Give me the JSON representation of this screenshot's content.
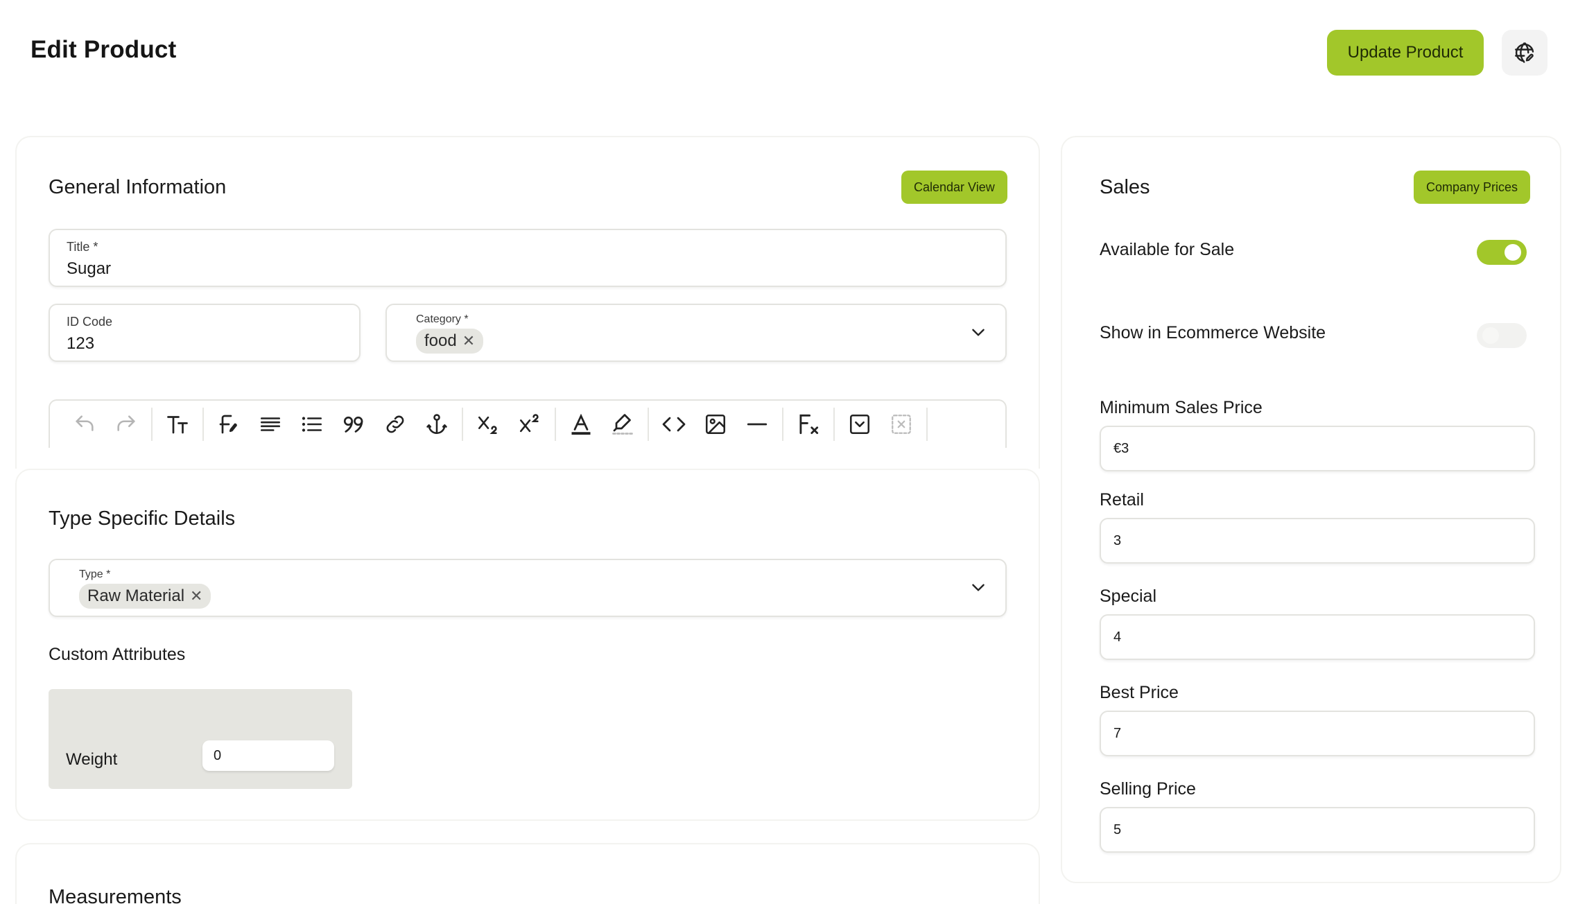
{
  "header": {
    "title": "Edit Product",
    "update_button": "Update Product",
    "language_icon": "globe-edit-icon"
  },
  "general": {
    "title": "General Information",
    "calendar_button": "Calendar View",
    "title_field": {
      "label": "Title *",
      "value": "Sugar"
    },
    "id_field": {
      "label": "ID Code",
      "value": "123"
    },
    "category_field": {
      "label": "Category *",
      "chips": [
        "food"
      ]
    },
    "toolbar_icons": [
      "undo-icon",
      "redo-icon",
      "text-size-icon",
      "font-icon",
      "align-icon",
      "bullet-list-icon",
      "quote-icon",
      "link-icon",
      "anchor-icon",
      "subscript-icon",
      "superscript-icon",
      "text-color-icon",
      "highlight-icon",
      "code-icon",
      "image-icon",
      "horizontal-rule-icon",
      "clear-format-icon",
      "checkbox-icon",
      "remove-icon"
    ]
  },
  "type_details": {
    "title": "Type Specific Details",
    "type_field": {
      "label": "Type *",
      "chips": [
        "Raw Material"
      ]
    },
    "custom_attributes_label": "Custom Attributes",
    "attributes": [
      {
        "label": "Weight",
        "value": "0"
      }
    ]
  },
  "measurements": {
    "title": "Measurements"
  },
  "sales": {
    "title": "Sales",
    "company_prices_button": "Company Prices",
    "available_for_sale": {
      "label": "Available for Sale",
      "on": true
    },
    "show_in_ecommerce": {
      "label": "Show in Ecommerce Website",
      "on": false
    },
    "prices": [
      {
        "label": "Minimum Sales Price",
        "value": "€3"
      },
      {
        "label": "Retail",
        "value": "3"
      },
      {
        "label": "Special",
        "value": "4"
      },
      {
        "label": "Best Price",
        "value": "7"
      },
      {
        "label": "Selling Price",
        "value": "5"
      }
    ]
  },
  "colors": {
    "accent": "#a2c72a",
    "chip": "#e6e6e1",
    "attr_bg": "#e5e5e0"
  }
}
